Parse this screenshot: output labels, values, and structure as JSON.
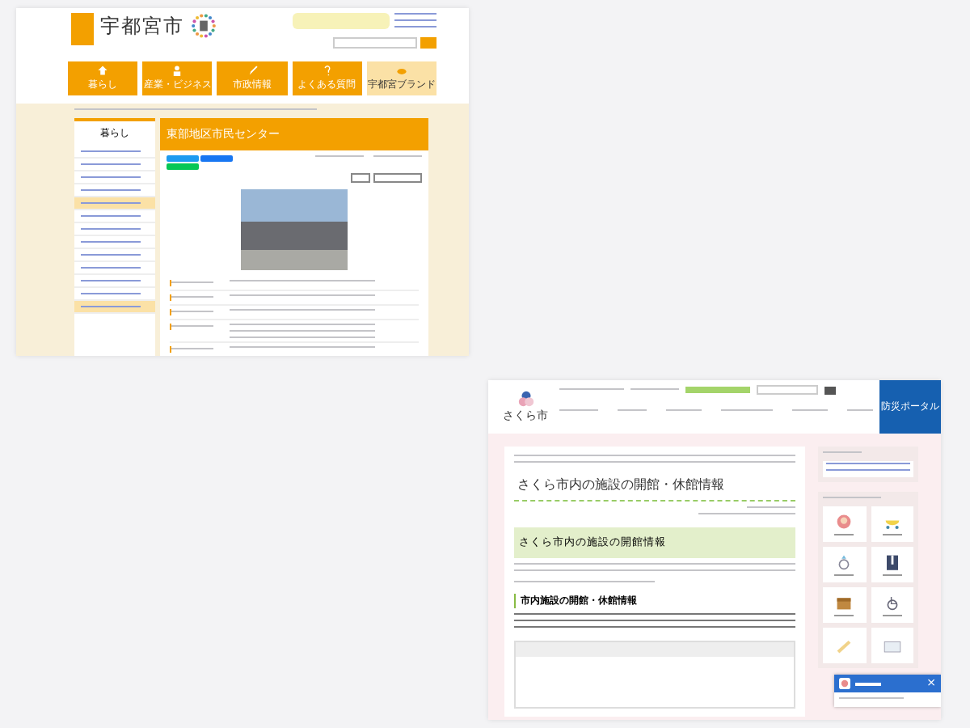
{
  "left_page": {
    "city_name": "宇都宮市",
    "nav": [
      {
        "label": "暮らし"
      },
      {
        "label": "産業・ビジネス"
      },
      {
        "label": "市政情報"
      },
      {
        "label": "よくある質問"
      },
      {
        "label": "宇都宮ブランド"
      }
    ],
    "sidebar": {
      "title": "暮らし",
      "items": [
        {
          "selected": false
        },
        {
          "selected": false
        },
        {
          "selected": false
        },
        {
          "selected": false
        },
        {
          "selected": true
        },
        {
          "selected": false
        },
        {
          "selected": false
        },
        {
          "selected": false
        },
        {
          "selected": false
        },
        {
          "selected": false
        },
        {
          "selected": false
        },
        {
          "selected": false
        },
        {
          "selected": true
        }
      ]
    },
    "heading": "東部地区市民センター",
    "share_buttons": [
      {
        "color": "#1d9bf0"
      },
      {
        "color": "#1877f2"
      },
      {
        "color": "#06c755"
      }
    ]
  },
  "right_page": {
    "city_name": "さくら市",
    "portal_button": "防災ポータル",
    "heading": "さくら市内の施設の開館・休館情報",
    "section_title": "さくら市内の施設の開館情報",
    "subsection_title": "市内施設の開館・休館情報",
    "chat": {
      "close": "×"
    }
  }
}
